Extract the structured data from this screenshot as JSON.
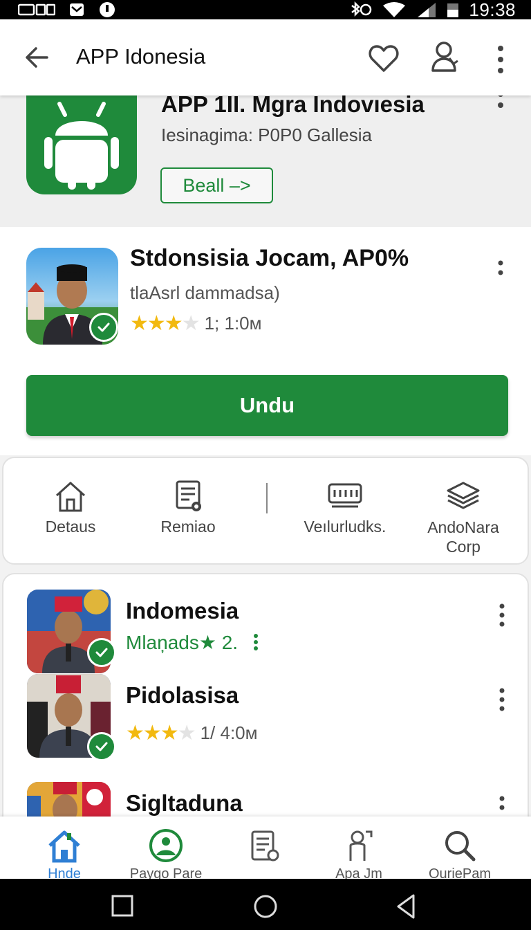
{
  "status_bar": {
    "time": "19:38"
  },
  "app_bar": {
    "title": "APP Idonesia"
  },
  "featured": {
    "title": "APP 1II. Mgra Indovıesia",
    "subtitle": "Iesinagima: P0P0 Gallesia",
    "button_label": "Beall –>"
  },
  "app": {
    "title": "Stdonsisia Jocam, AP0%",
    "subtitle": "tlaAsrl dammadsa)",
    "rating_stars": 3,
    "rating_text": "1; 1:0м",
    "install_label": "Undu"
  },
  "info_items": [
    {
      "label": "Detaus",
      "icon": "home-icon"
    },
    {
      "label": "Remiao",
      "icon": "document-icon"
    },
    {
      "label": "Veılurludks.",
      "icon": "keyboard-icon"
    },
    {
      "label": "AndoNara Corp",
      "icon": "layers-icon"
    }
  ],
  "list": [
    {
      "title": "Indomesia",
      "meta": "Mlaņads",
      "meta_rating": "★ 2.",
      "verified": true
    },
    {
      "title": "Pidolasisa",
      "rating_stars": 3,
      "rating_text": "1/ 4:0м",
      "verified": true
    },
    {
      "title": "Sigltaduna"
    }
  ],
  "bottom_nav": [
    {
      "label": "Hnde",
      "icon": "home-icon",
      "active": true
    },
    {
      "label": "Paygo Pare",
      "icon": "profile-icon"
    },
    {
      "label": "",
      "icon": "receipt-icon"
    },
    {
      "label": "Apa Jm",
      "icon": "person-icon"
    },
    {
      "label": "OuriePam",
      "icon": "search-icon"
    }
  ],
  "colors": {
    "accent": "#1f8a3b",
    "star": "#f2b90f"
  }
}
